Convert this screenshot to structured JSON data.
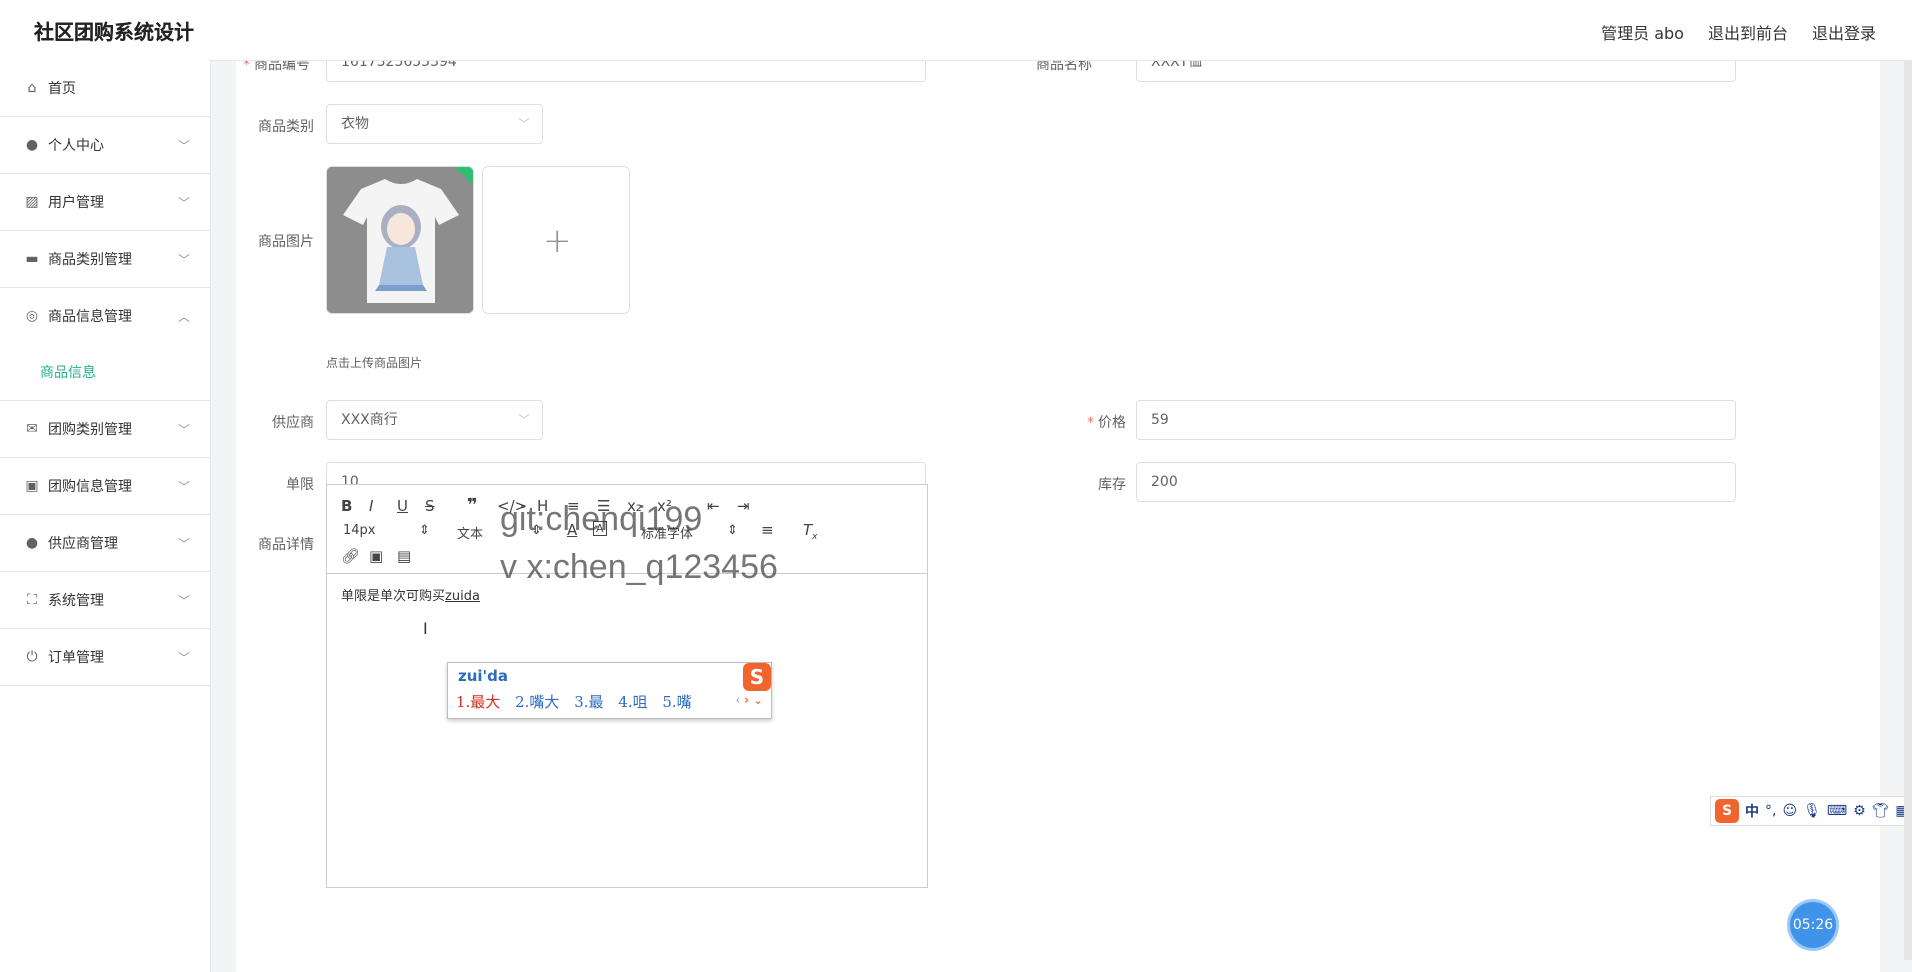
{
  "header": {
    "title": "社区团购系统设计",
    "admin": "管理员 abo",
    "to_front": "退出到前台",
    "logout": "退出登录"
  },
  "sidebar": {
    "items": [
      {
        "label": "首页",
        "icon": "home-icon"
      },
      {
        "label": "个人中心",
        "icon": "user-icon"
      },
      {
        "label": "用户管理",
        "icon": "chart-icon"
      },
      {
        "label": "商品类别管理",
        "icon": "briefcase-icon"
      },
      {
        "label": "商品信息管理",
        "icon": "circle-icon"
      },
      {
        "label": "团购类别管理",
        "icon": "mail-icon"
      },
      {
        "label": "团购信息管理",
        "icon": "clipboard-icon"
      },
      {
        "label": "供应商管理",
        "icon": "user-icon"
      },
      {
        "label": "系统管理",
        "icon": "fullscreen-icon"
      },
      {
        "label": "订单管理",
        "icon": "power-icon"
      }
    ],
    "sub_item": "商品信息"
  },
  "form": {
    "product_no_label": "商品编号",
    "product_no_value": "1617325655394",
    "product_name_label": "商品名称",
    "product_name_value": "XXXT恤",
    "category_label": "商品类别",
    "category_value": "衣物",
    "image_label": "商品图片",
    "upload_tip": "点击上传商品图片",
    "supplier_label": "供应商",
    "supplier_value": "XXX商行",
    "price_label": "价格",
    "price_value": "59",
    "limit_label": "单限",
    "limit_value": "10",
    "stock_label": "库存",
    "stock_value": "200",
    "detail_label": "商品详情"
  },
  "editor": {
    "font_size": "14px",
    "block_type": "文本",
    "font_family": "标准字体",
    "body_text": "单限是单次可购买",
    "composing": "zuida"
  },
  "watermark": {
    "line1": "git:chenqi199",
    "line2": "v x:chen_q123456"
  },
  "ime": {
    "input": "zui'da",
    "candidates": [
      "1.最大",
      "2.嘴大",
      "3.最",
      "4.咀",
      "5.嘴"
    ],
    "logo": "S"
  },
  "tray": {
    "lang": "中",
    "punct": "°,"
  },
  "timer": "05:26"
}
